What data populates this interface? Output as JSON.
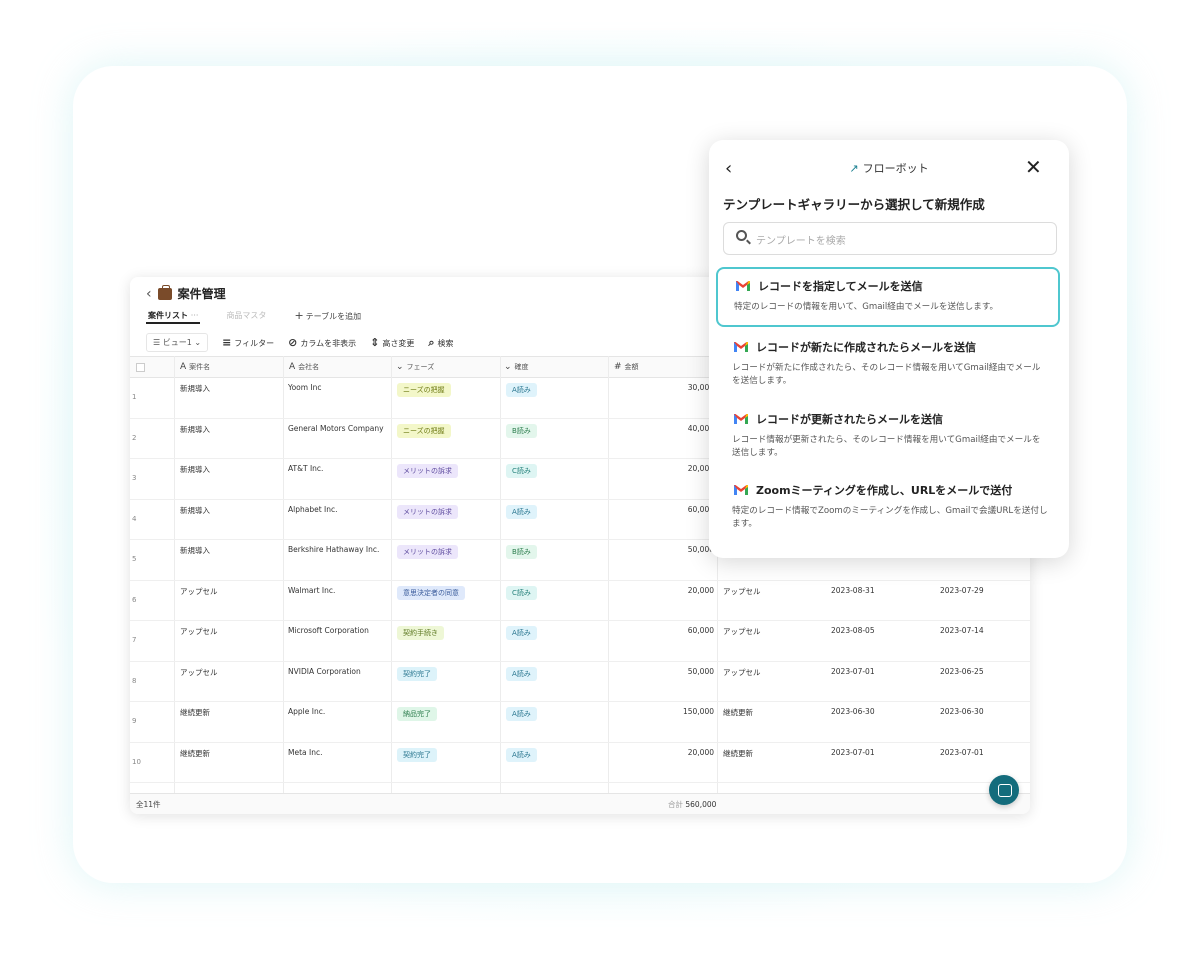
{
  "table": {
    "title": "案件管理",
    "tabs": [
      "案件リスト",
      "商品マスタ"
    ],
    "tab_more": "···",
    "add_table": "テーブルを追加",
    "toolbar": {
      "view": "ビュー1",
      "filter": "フィルター",
      "hide_columns": "カラムを非表示",
      "height": "高さ変更",
      "search": "検索"
    },
    "columns": [
      "案件名",
      "会社名",
      "フェーズ",
      "確度",
      "金額"
    ],
    "rows": [
      {
        "num": "1",
        "name": "新規導入",
        "company": "Yoom Inc",
        "phase": "ニーズの把握",
        "prob": "A読み",
        "amount": "30,000",
        "type": "",
        "d1": "",
        "d2": ""
      },
      {
        "num": "2",
        "name": "新規導入",
        "company": "General Motors Company",
        "phase": "ニーズの把握",
        "prob": "B読み",
        "amount": "40,000",
        "type": "",
        "d1": "",
        "d2": ""
      },
      {
        "num": "3",
        "name": "新規導入",
        "company": "AT&T Inc.",
        "phase": "メリットの訴求",
        "prob": "C読み",
        "amount": "20,000",
        "type": "",
        "d1": "",
        "d2": ""
      },
      {
        "num": "4",
        "name": "新規導入",
        "company": "Alphabet Inc.",
        "phase": "メリットの訴求",
        "prob": "A読み",
        "amount": "60,000",
        "type": "",
        "d1": "",
        "d2": ""
      },
      {
        "num": "5",
        "name": "新規導入",
        "company": "Berkshire Hathaway Inc.",
        "phase": "メリットの訴求",
        "prob": "B読み",
        "amount": "50,000",
        "type": "",
        "d1": "",
        "d2": ""
      },
      {
        "num": "6",
        "name": "アップセル",
        "company": "Walmart Inc.",
        "phase": "意思決定者の同意",
        "prob": "C読み",
        "amount": "20,000",
        "type": "アップセル",
        "d1": "2023-08-31",
        "d2": "2023-07-29"
      },
      {
        "num": "7",
        "name": "アップセル",
        "company": "Microsoft Corporation",
        "phase": "契約手続き",
        "prob": "A読み",
        "amount": "60,000",
        "type": "アップセル",
        "d1": "2023-08-05",
        "d2": "2023-07-14"
      },
      {
        "num": "8",
        "name": "アップセル",
        "company": "NVIDIA Corporation",
        "phase": "契約完了",
        "prob": "A読み",
        "amount": "50,000",
        "type": "アップセル",
        "d1": "2023-07-01",
        "d2": "2023-06-25"
      },
      {
        "num": "9",
        "name": "継続更新",
        "company": "Apple Inc.",
        "phase": "納品完了",
        "prob": "A読み",
        "amount": "150,000",
        "type": "継続更新",
        "d1": "2023-06-30",
        "d2": "2023-06-30"
      },
      {
        "num": "10",
        "name": "継続更新",
        "company": "Meta Inc.",
        "phase": "契約完了",
        "prob": "A読み",
        "amount": "20,000",
        "type": "継続更新",
        "d1": "2023-07-01",
        "d2": "2023-07-01"
      }
    ],
    "footer_count": "全11件",
    "footer_sum_label": "合計",
    "footer_sum": "560,000"
  },
  "phase_colors": {
    "ニーズの把握": [
      "#f3f7c9",
      "#6d7a13"
    ],
    "メリットの訴求": [
      "#ece6fb",
      "#5d4a9e"
    ],
    "意思決定者の同意": [
      "#dfe9fb",
      "#3b5c9c"
    ],
    "契約手続き": [
      "#eef7d6",
      "#5b7720"
    ],
    "契約完了": [
      "#ddf3fa",
      "#2b7790"
    ],
    "納品完了": [
      "#dff6e8",
      "#2d7d4e"
    ]
  },
  "prob_colors": {
    "A読み": [
      "#dff3fb",
      "#2b7790"
    ],
    "B読み": [
      "#e3f6ec",
      "#2d7d4e"
    ],
    "C読み": [
      "#def5f3",
      "#24807a"
    ]
  },
  "panel": {
    "title": "フローボット",
    "heading": "テンプレートギャラリーから選択して新規作成",
    "search_placeholder": "テンプレートを検索",
    "templates": [
      {
        "title": "レコードを指定してメールを送信",
        "desc": "特定のレコードの情報を用いて、Gmail経由でメールを送信します。"
      },
      {
        "title": "レコードが新たに作成されたらメールを送信",
        "desc": "レコードが新たに作成されたら、そのレコード情報を用いてGmail経由でメールを送信します。"
      },
      {
        "title": "レコードが更新されたらメールを送信",
        "desc": "レコード情報が更新されたら、そのレコード情報を用いてGmail経由でメールを送信します。"
      },
      {
        "title": "Zoomミーティングを作成し、URLをメールで送付",
        "desc": "特定のレコード情報でZoomのミーティングを作成し、Gmailで会議URLを送付します。"
      }
    ]
  }
}
